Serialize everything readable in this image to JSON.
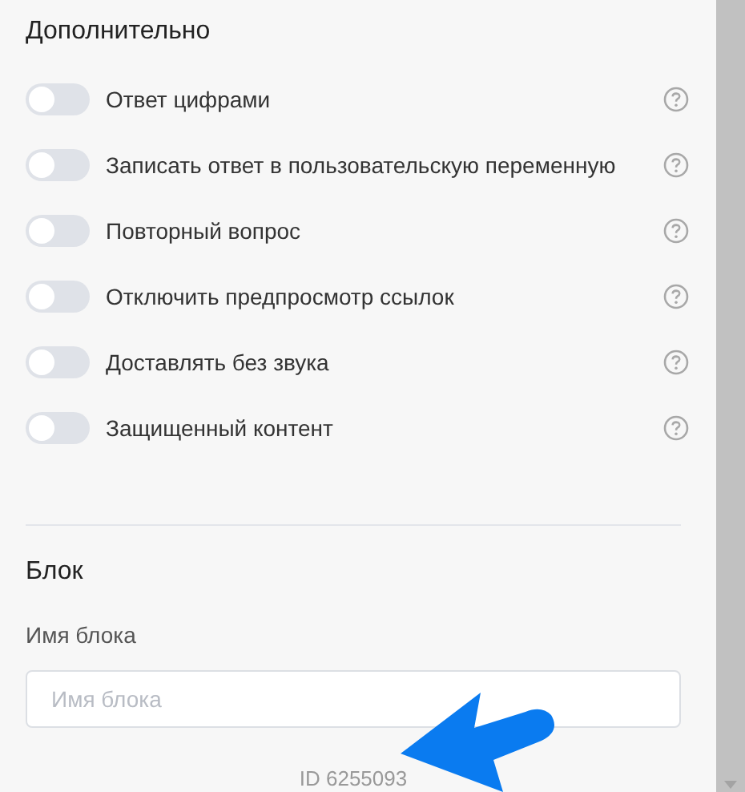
{
  "advanced": {
    "title": "Дополнительно",
    "options": [
      {
        "label": "Ответ цифрами",
        "on": false
      },
      {
        "label": "Записать ответ в пользовательскую переменную",
        "on": false
      },
      {
        "label": "Повторный вопрос",
        "on": false
      },
      {
        "label": "Отключить предпросмотр ссылок",
        "on": false
      },
      {
        "label": "Доставлять без звука",
        "on": false
      },
      {
        "label": "Защищенный контент",
        "on": false
      }
    ]
  },
  "block": {
    "title": "Блок",
    "name_label": "Имя блока",
    "name_field": {
      "placeholder": "Имя блока"
    },
    "id": "ID 6255093"
  }
}
